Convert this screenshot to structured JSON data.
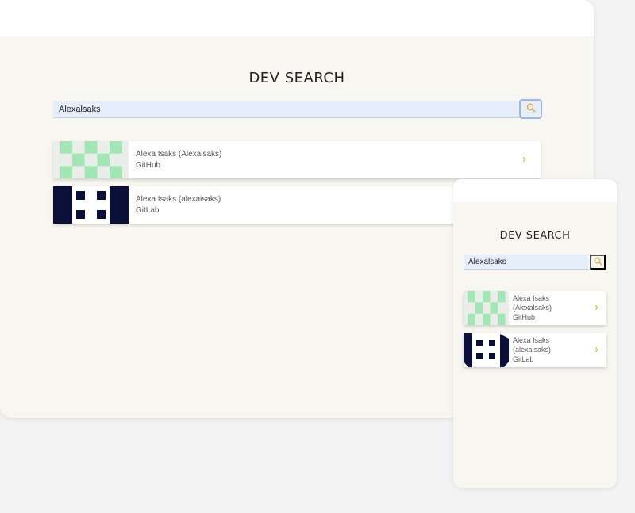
{
  "desktop": {
    "title": "DEV SEARCH",
    "search": {
      "value": "Alexalsaks"
    },
    "results": [
      {
        "name": "Alexa Isaks (Alexalsaks)",
        "source": "GitHub"
      },
      {
        "name": "Alexa Isaks (alexaisaks)",
        "source": "GitLab"
      }
    ]
  },
  "mobile": {
    "title": "DEV SEARCH",
    "search": {
      "value": "Alexalsaks"
    },
    "results": [
      {
        "name": "Alexa Isaks (Alexalsaks)",
        "source": "GitHub"
      },
      {
        "name": "Alexa Isaks (alexaisaks)",
        "source": "GitLab"
      }
    ]
  },
  "icons": {
    "search": "search-icon",
    "chevron": "chevron-right-icon",
    "github_avatar": "github-identicon",
    "gitlab_avatar": "gitlab-identicon"
  },
  "colors": {
    "accent": "#e0a92b",
    "github_avatar": "#a3e6b5",
    "gitlab_avatar": "#0b1038",
    "search_field": "#e6eefc",
    "panel_bg": "#f8f6f1"
  }
}
